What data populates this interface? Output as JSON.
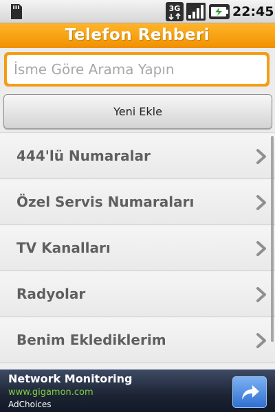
{
  "statusbar": {
    "time": "22:45",
    "network_label": "3G",
    "icons": [
      "sd-card-icon",
      "network-3g-icon",
      "signal-icon",
      "battery-icon"
    ]
  },
  "header": {
    "title": "Telefon Rehberi"
  },
  "search": {
    "placeholder": "İsme Göre Arama Yapın",
    "value": ""
  },
  "actions": {
    "add_label": "Yeni Ekle"
  },
  "list": {
    "items": [
      {
        "label": "444'lü Numaralar"
      },
      {
        "label": "Özel Servis Numaraları"
      },
      {
        "label": "TV Kanalları"
      },
      {
        "label": "Radyolar"
      },
      {
        "label": "Benim Eklediklerim"
      }
    ]
  },
  "ad": {
    "title": "Network Monitoring",
    "url": "www.gigamon.com",
    "choices": "AdChoices"
  },
  "colors": {
    "accent_orange": "#f39a12",
    "list_text": "#5f5f5f",
    "ad_url_green": "#7ed03e",
    "ad_button_blue": "#2f6fd2"
  }
}
